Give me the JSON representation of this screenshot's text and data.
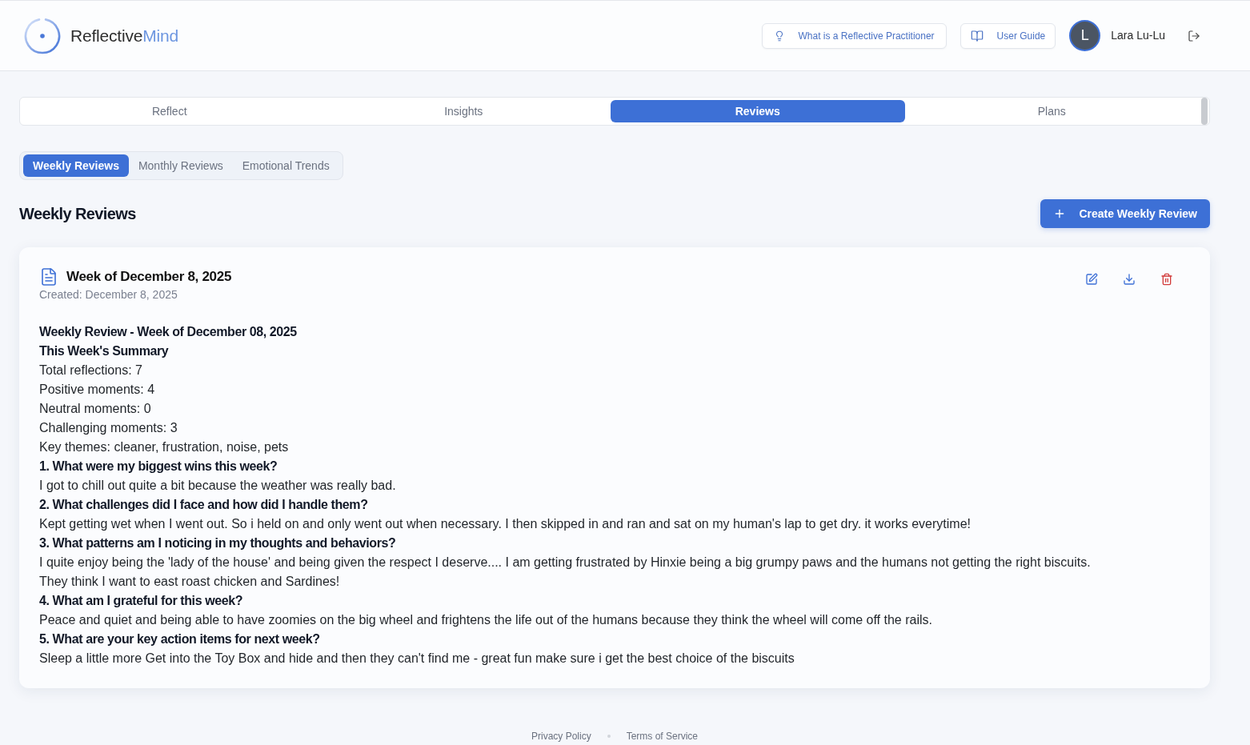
{
  "header": {
    "logo": {
      "text": "Reflective",
      "accent": "Mind"
    },
    "info_button": {
      "label": "What is a Reflective Practitioner"
    },
    "guide_button": {
      "label": "User Guide"
    },
    "user": {
      "initial": "L",
      "name": "Lara Lu-Lu"
    }
  },
  "main_tabs": [
    {
      "label": "Reflect",
      "selected": false
    },
    {
      "label": "Insights",
      "selected": false
    },
    {
      "label": "Reviews",
      "selected": true
    },
    {
      "label": "Plans",
      "selected": false
    }
  ],
  "sub_tabs": [
    {
      "label": "Weekly Reviews",
      "selected": true
    },
    {
      "label": "Monthly Reviews",
      "selected": false
    },
    {
      "label": "Emotional Trends",
      "selected": false
    }
  ],
  "section": {
    "title": "Weekly Reviews",
    "create_button": "Create Weekly Review"
  },
  "reviews": [
    {
      "title": "Week of December 8, 2025",
      "created": "Created: December 8, 2025",
      "body": [
        {
          "kind": "heading",
          "text": "Weekly Review - Week of December 08, 2025"
        },
        {
          "kind": "heading",
          "text": "This Week's Summary"
        },
        {
          "kind": "text",
          "text": "Total reflections: 7"
        },
        {
          "kind": "text",
          "text": "Positive moments: 4"
        },
        {
          "kind": "text",
          "text": "Neutral moments: 0"
        },
        {
          "kind": "text",
          "text": "Challenging moments: 3"
        },
        {
          "kind": "text",
          "text": "Key themes: cleaner, frustration, noise, pets"
        },
        {
          "kind": "heading",
          "text": "1. What were my biggest wins this week?"
        },
        {
          "kind": "text",
          "text": "I got to chill out quite a bit because the weather was really bad."
        },
        {
          "kind": "heading",
          "text": "2. What challenges did I face and how did I handle them?"
        },
        {
          "kind": "text",
          "text": "Kept getting wet when I went out. So i held on and only went out when necessary. I then skipped in and ran and sat on my human's lap to get dry. it works everytime!"
        },
        {
          "kind": "heading",
          "text": "3. What patterns am I noticing in my thoughts and behaviors?"
        },
        {
          "kind": "text",
          "text": "I quite enjoy being the 'lady of the house' and being given the respect I deserve.... I am getting frustrated by Hinxie being a big grumpy paws and the humans not getting the right biscuits. They think I want to east roast chicken and Sardines!"
        },
        {
          "kind": "heading",
          "text": "4. What am I grateful for this week?"
        },
        {
          "kind": "text",
          "text": "Peace and quiet and being able to have zoomies on the big wheel and frightens the life out of the humans because they think the wheel will come off the rails."
        },
        {
          "kind": "heading",
          "text": "5. What are your key action items for next week?"
        },
        {
          "kind": "text",
          "text": "Sleep a little more Get into the Toy Box and hide and then they can't find me - great fun make sure i get the best choice of the biscuits"
        }
      ]
    }
  ],
  "footer": {
    "links": [
      "Privacy Policy",
      "Terms of Service"
    ]
  }
}
